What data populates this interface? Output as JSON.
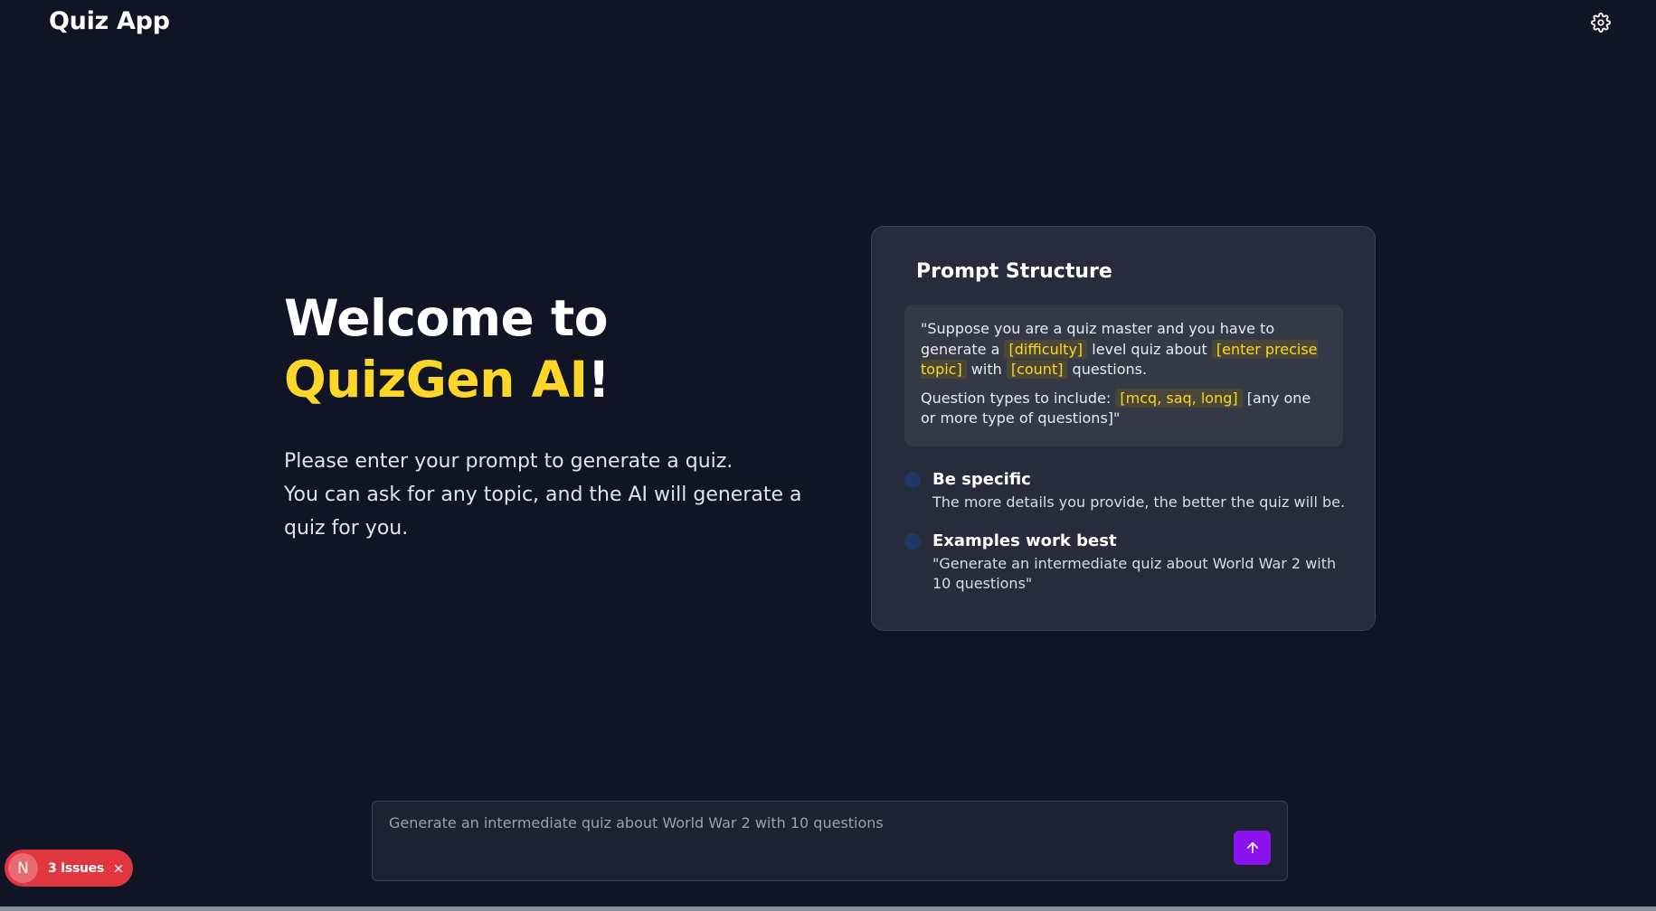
{
  "header": {
    "title": "Quiz App",
    "settings_icon": "gear-icon"
  },
  "hero": {
    "line1": "Welcome to",
    "brand": "QuizGen AI",
    "exclamation": "!",
    "description_line1": "Please enter your prompt to generate a quiz.",
    "description_line2": "You can ask for any topic, and the AI will generate a quiz for you."
  },
  "card": {
    "title": "Prompt Structure",
    "prompt": {
      "t1": "\"Suppose you are a quiz master and you have to generate a ",
      "difficulty": "[difficulty]",
      "t2": " level quiz about ",
      "topic": "[enter precise topic]",
      "t3": " with ",
      "count": "[count]",
      "t4": " questions.",
      "t5": "Question types to include: ",
      "types": "[mcq, saq, long]",
      "t6": " [any one or more type of questions]\""
    },
    "tips": [
      {
        "title": "Be specific",
        "description": "The more details you provide, the better the quiz will be."
      },
      {
        "title": "Examples work best",
        "description": "\"Generate an intermediate quiz about World War 2 with 10 questions\""
      }
    ]
  },
  "input": {
    "placeholder": "Generate an intermediate quiz about World War 2 with 10 questions",
    "value": "",
    "send_icon": "arrow-up-icon"
  },
  "issues_badge": {
    "avatar": "N",
    "label": "3 Issues",
    "close_icon": "close-icon"
  },
  "colors": {
    "background": "#0f1524",
    "accent_yellow": "#fcd629",
    "send_button": "#8a13f0",
    "issues_badge": "#e1353f",
    "card": "#262c3b"
  }
}
